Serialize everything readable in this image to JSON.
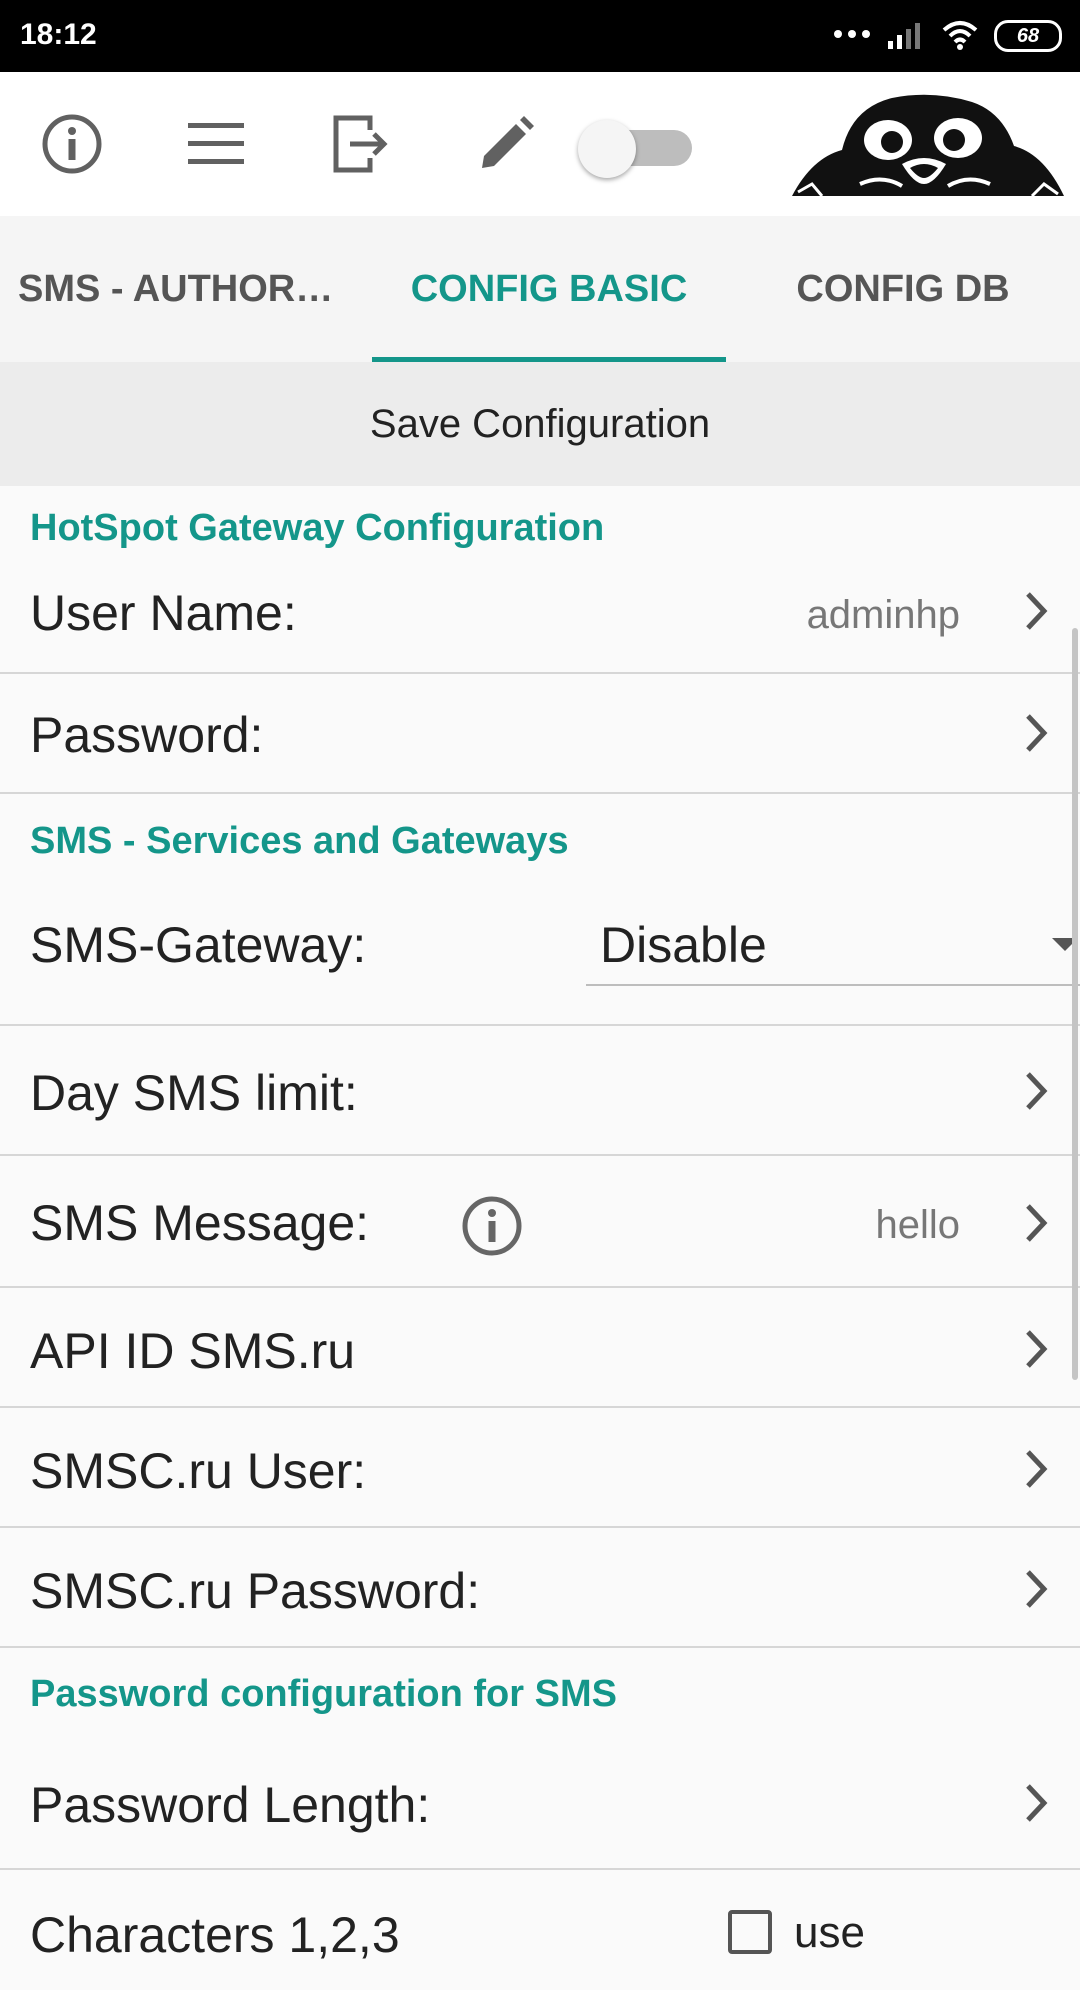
{
  "status_bar": {
    "time": "18:12",
    "battery": "68",
    "icons": [
      "dots-icon",
      "signal-icon",
      "wifi-icon",
      "battery-icon"
    ]
  },
  "toolbar": {
    "icons": [
      "info-icon",
      "menu-icon",
      "exit-icon",
      "edit-icon"
    ],
    "toggle_on": false,
    "logo": "pug-logo-image"
  },
  "tabs": [
    {
      "label": "SMS - AUTHOR…",
      "active": false
    },
    {
      "label": "CONFIG BASIC",
      "active": true
    },
    {
      "label": "CONFIG DB",
      "active": false
    }
  ],
  "save_button": "Save Configuration",
  "sections": {
    "hotspot": {
      "title": "HotSpot Gateway Configuration",
      "user_name_label": "User Name:",
      "user_name_value": "adminhp",
      "password_label": "Password:"
    },
    "sms": {
      "title": "SMS - Services and Gateways",
      "gateway_label": "SMS-Gateway:",
      "gateway_value": "Disable",
      "day_limit_label": "Day SMS limit:",
      "message_label": "SMS Message:",
      "message_value": "hello",
      "api_id_label": "API ID SMS.ru",
      "smsc_user_label": "SMSC.ru User:",
      "smsc_password_label": "SMSC.ru Password:"
    },
    "password": {
      "title": "Password configuration for SMS",
      "length_label": "Password Length:",
      "characters_label": "Characters 1,2,3",
      "use_label": "use"
    }
  },
  "colors": {
    "accent": "#14968a",
    "status_bar": "#000000",
    "save_bar": "#ececec"
  }
}
